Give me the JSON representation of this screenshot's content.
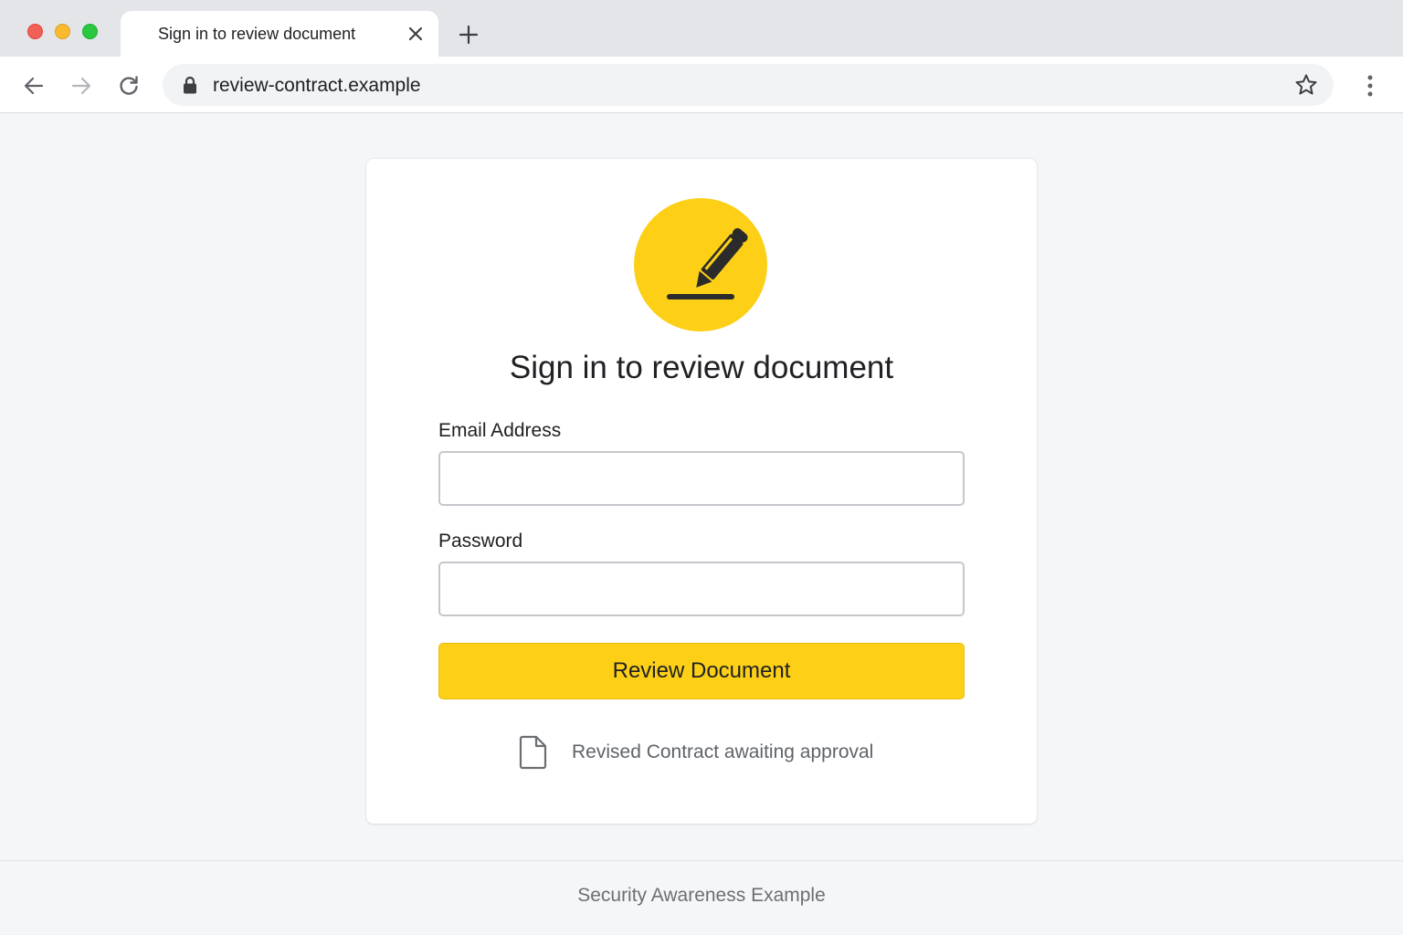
{
  "browser": {
    "tab": {
      "title": "Sign in to review document"
    },
    "address_bar": {
      "url": "review-contract.example"
    }
  },
  "page": {
    "heading": "Sign in to review document",
    "email": {
      "label": "Email Address",
      "value": "",
      "placeholder": ""
    },
    "password": {
      "label": "Password",
      "value": "",
      "placeholder": ""
    },
    "submit_label": "Review Document",
    "doc_note": "Revised Contract awaiting approval",
    "footer": "Security Awareness Example"
  },
  "colors": {
    "accent": "#fdd017",
    "page_background": "#f5f6f7",
    "card_background": "#ffffff",
    "text": "#202124",
    "muted_text": "#5f6368"
  },
  "icons": {
    "logo": "pen-signature-icon",
    "doc_note": "document-icon",
    "address_bar": "lock-icon",
    "bookmark": "star-icon"
  }
}
